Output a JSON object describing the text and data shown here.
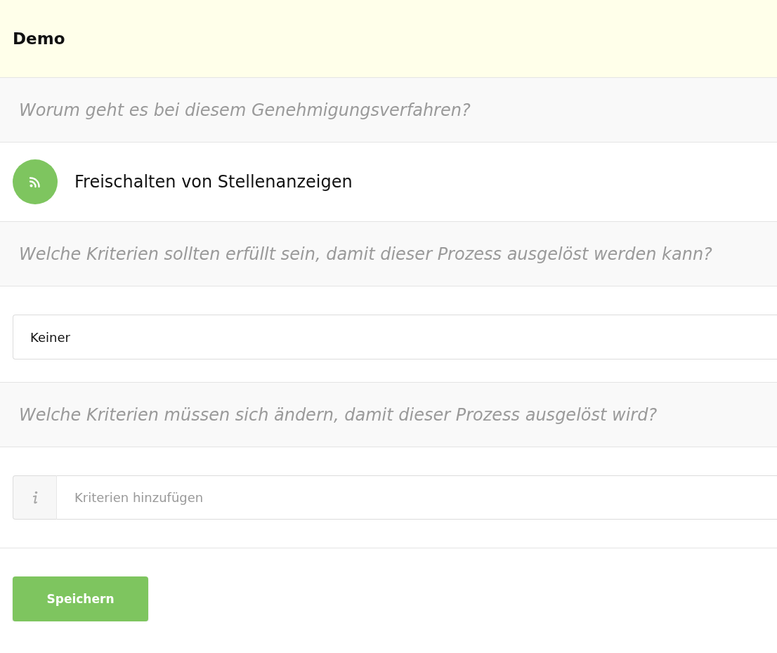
{
  "header": {
    "title": "Demo"
  },
  "sections": [
    {
      "kind": "question",
      "text": "Worum geht es bei diesem Genehmigungsverfahren?"
    },
    {
      "kind": "answer",
      "text": "Freischalten von Stellenanzeigen"
    },
    {
      "kind": "question",
      "text": "Welche Kriterien sollten erfüllt sein, damit dieser Prozess ausgelöst werden kann?"
    },
    {
      "kind": "field",
      "value": "Keiner"
    },
    {
      "kind": "question",
      "text": "Welche Kriterien müssen sich ändern, damit dieser Prozess ausgelöst wird?"
    },
    {
      "kind": "input",
      "placeholder": "Kriterien hinzufügen"
    }
  ],
  "button": {
    "label": "Speichern"
  }
}
